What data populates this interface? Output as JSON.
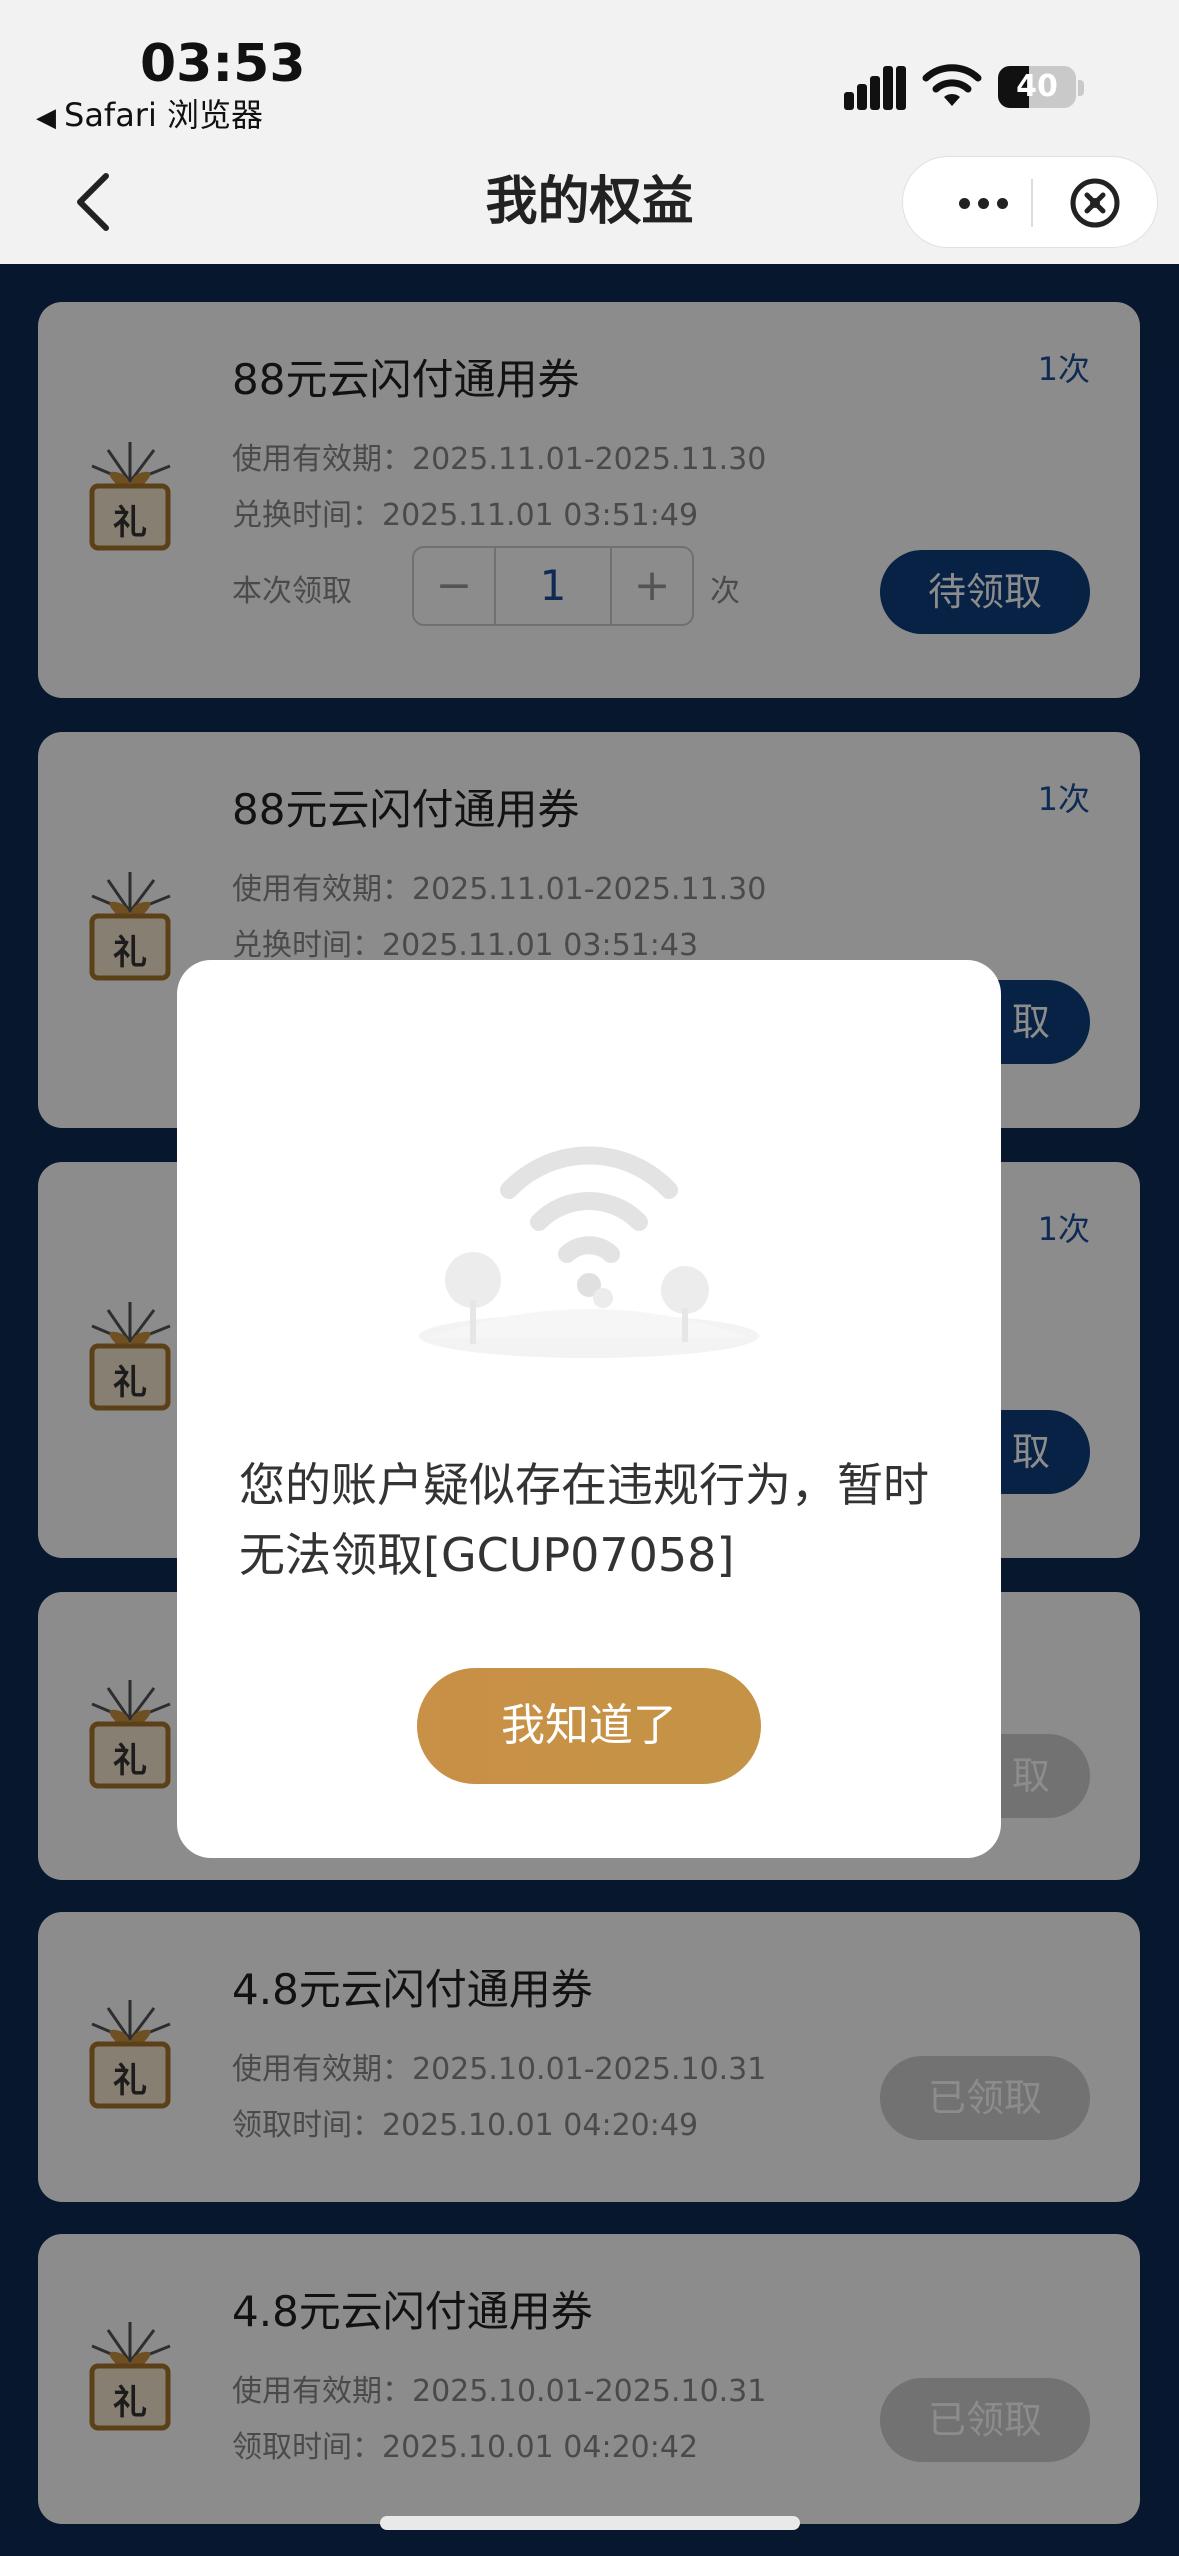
{
  "status_bar": {
    "time": "03:53",
    "back_app": "Safari 浏览器",
    "battery": "40"
  },
  "nav": {
    "title": "我的权益"
  },
  "cards": [
    {
      "title": "88元云闪付通用券",
      "count": "1次",
      "validity": "使用有效期：2025.11.01-2025.11.30",
      "time": "兑换时间：2025.11.01 03:51:49",
      "qty_label": "本次领取",
      "qty_minus": "−",
      "qty_value": "1",
      "qty_plus": "+",
      "qty_unit": "次",
      "button": "待领取"
    },
    {
      "title": "88元云闪付通用券",
      "count": "1次",
      "validity": "使用有效期：2025.11.01-2025.11.30",
      "time": "兑换时间：2025.11.01 03:51:43",
      "button": "取"
    },
    {
      "count": "1次",
      "button": "取"
    },
    {
      "button": "取"
    },
    {
      "title": "4.8元云闪付通用券",
      "validity": "使用有效期：2025.10.01-2025.10.31",
      "time": "领取时间：2025.10.01 04:20:49",
      "button": "已领取"
    },
    {
      "title": "4.8元云闪付通用券",
      "validity": "使用有效期：2025.10.01-2025.10.31",
      "time": "领取时间：2025.10.01 04:20:42",
      "button": "已领取"
    }
  ],
  "modal": {
    "message": "您的账户疑似存在违规行为，暂时无法领取[GCUP07058]",
    "button": "我知道了"
  },
  "colors": {
    "primary": "#0d3e7e",
    "modal_button": "#c99047",
    "page_bg": "#0b2a55"
  }
}
